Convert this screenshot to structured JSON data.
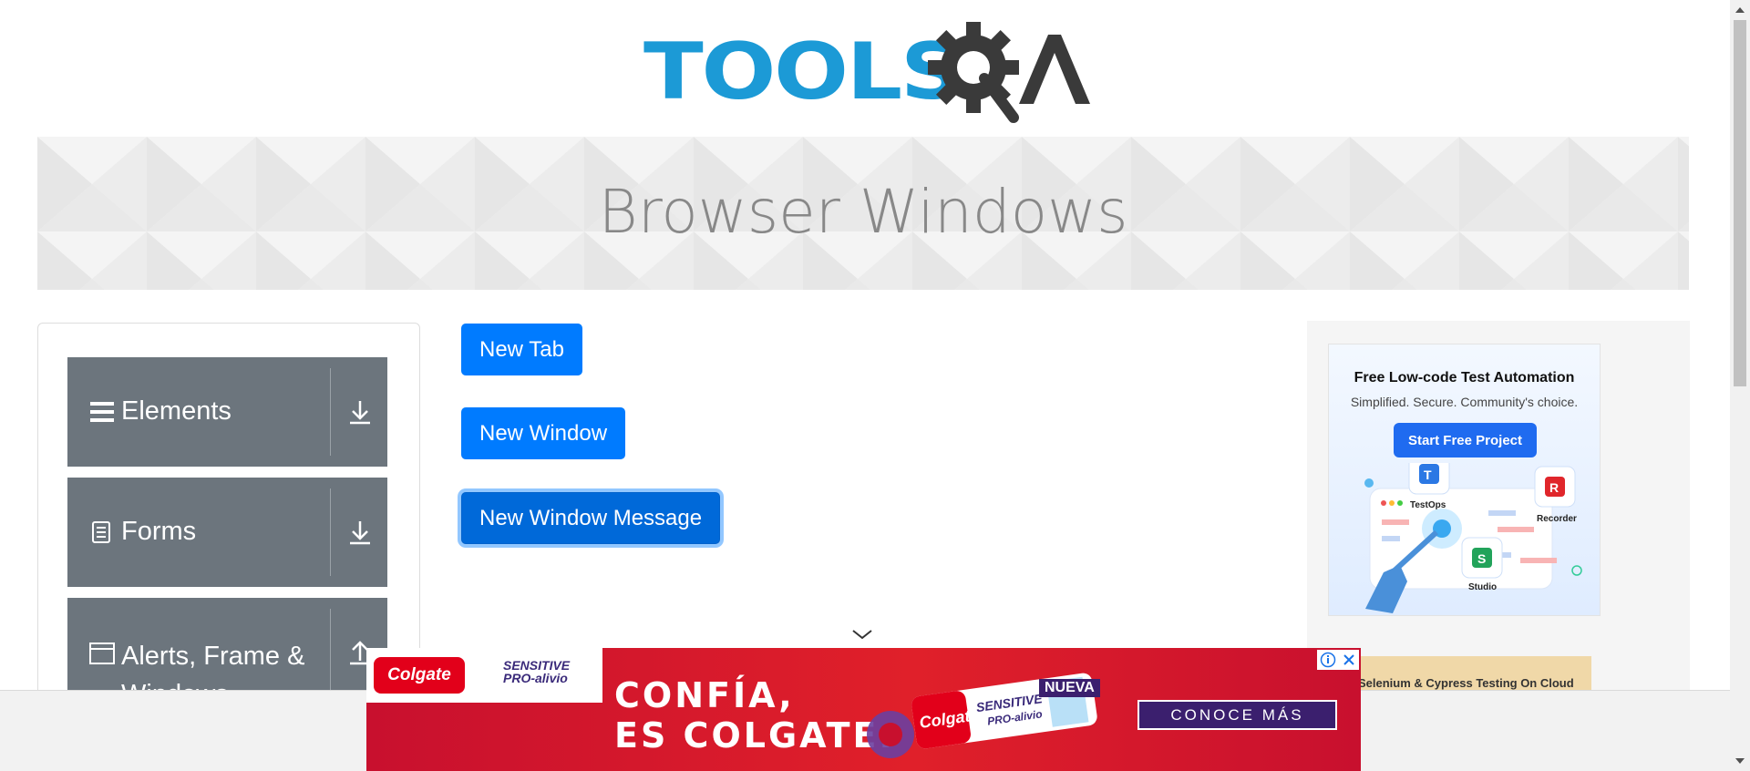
{
  "header": {
    "logo_text": "TOOLS",
    "logo_mark": "QA"
  },
  "banner": {
    "title": "Browser Windows"
  },
  "sidebar": {
    "groups": [
      {
        "label": "Elements",
        "icon": "hamburger-icon",
        "arrow": "download-arrow-icon"
      },
      {
        "label": "Forms",
        "icon": "document-icon",
        "arrow": "download-arrow-icon"
      },
      {
        "label": "Alerts, Frame & Windows",
        "icon": "window-icon",
        "arrow": "upload-arrow-icon"
      }
    ]
  },
  "main": {
    "buttons": [
      {
        "label": "New Tab"
      },
      {
        "label": "New Window"
      },
      {
        "label": "New Window Message",
        "state": "focused"
      }
    ]
  },
  "right_ad": {
    "title": "Free Low-code Test Automation",
    "subtitle": "Simplified. Secure. Community's choice.",
    "cta": "Start Free Project",
    "products": [
      "TestOps",
      "Recorder",
      "Studio"
    ],
    "strip_text": "Selenium & Cypress Testing On Cloud"
  },
  "bottom_ad": {
    "brand": "Colgate",
    "product": "SENSITIVE PRO-alivio",
    "headline_line1": "CONFÍA,",
    "headline_line2": "ES COLGATE.",
    "badge": "NUEVA",
    "cta": "CONOCE MÁS"
  },
  "colors": {
    "primary_button": "#007bff",
    "sidebar_group": "#6c757d",
    "logo_blue": "#1c9ad6",
    "ad_red": "#d71a28"
  }
}
